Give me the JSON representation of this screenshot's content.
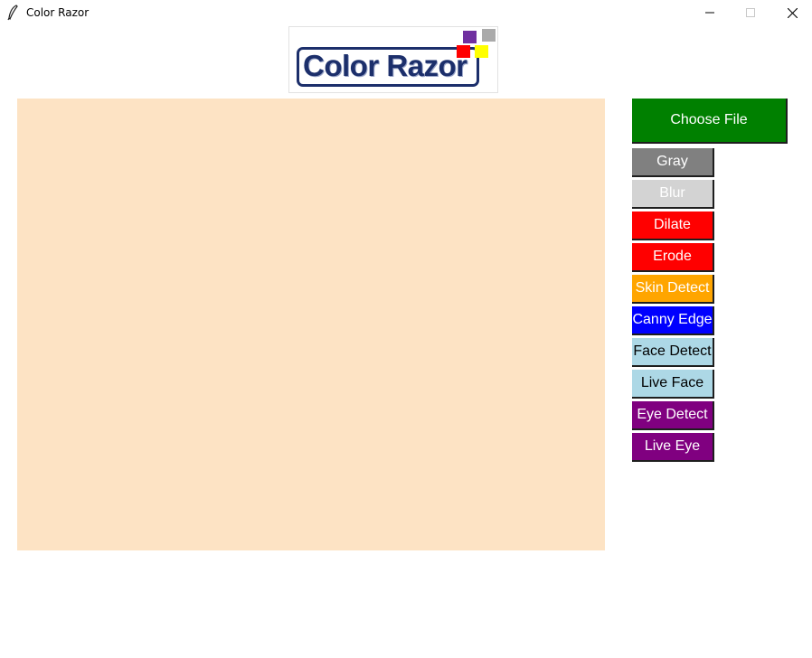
{
  "window": {
    "title": "Color Razor",
    "app_icon": "feather-icon",
    "controls": {
      "minimize_icon": "minimize-icon",
      "maximize_icon": "maximize-icon",
      "close_icon": "close-icon"
    }
  },
  "logo": {
    "text": "Color Razor",
    "square_colors": [
      "#7030a0",
      "#aaaaaa",
      "#ff0000",
      "#ffff00"
    ]
  },
  "canvas": {
    "background": "#fde3c4"
  },
  "choose_file": {
    "label": "Choose File",
    "color": "#008000"
  },
  "tools": [
    {
      "label": "Gray",
      "color": "#808080"
    },
    {
      "label": "Blur",
      "color": "#d3d3d3"
    },
    {
      "label": "Dilate",
      "color": "#ff0000"
    },
    {
      "label": "Erode",
      "color": "#ff0000"
    },
    {
      "label": "Skin Detect",
      "color": "#ffa500"
    },
    {
      "label": "Canny Edge",
      "color": "#0000ff"
    },
    {
      "label": "Face Detect",
      "color": "#add8e6"
    },
    {
      "label": "Live Face",
      "color": "#add8e6"
    },
    {
      "label": "Eye Detect",
      "color": "#800080"
    },
    {
      "label": "Live Eye",
      "color": "#800080"
    }
  ]
}
